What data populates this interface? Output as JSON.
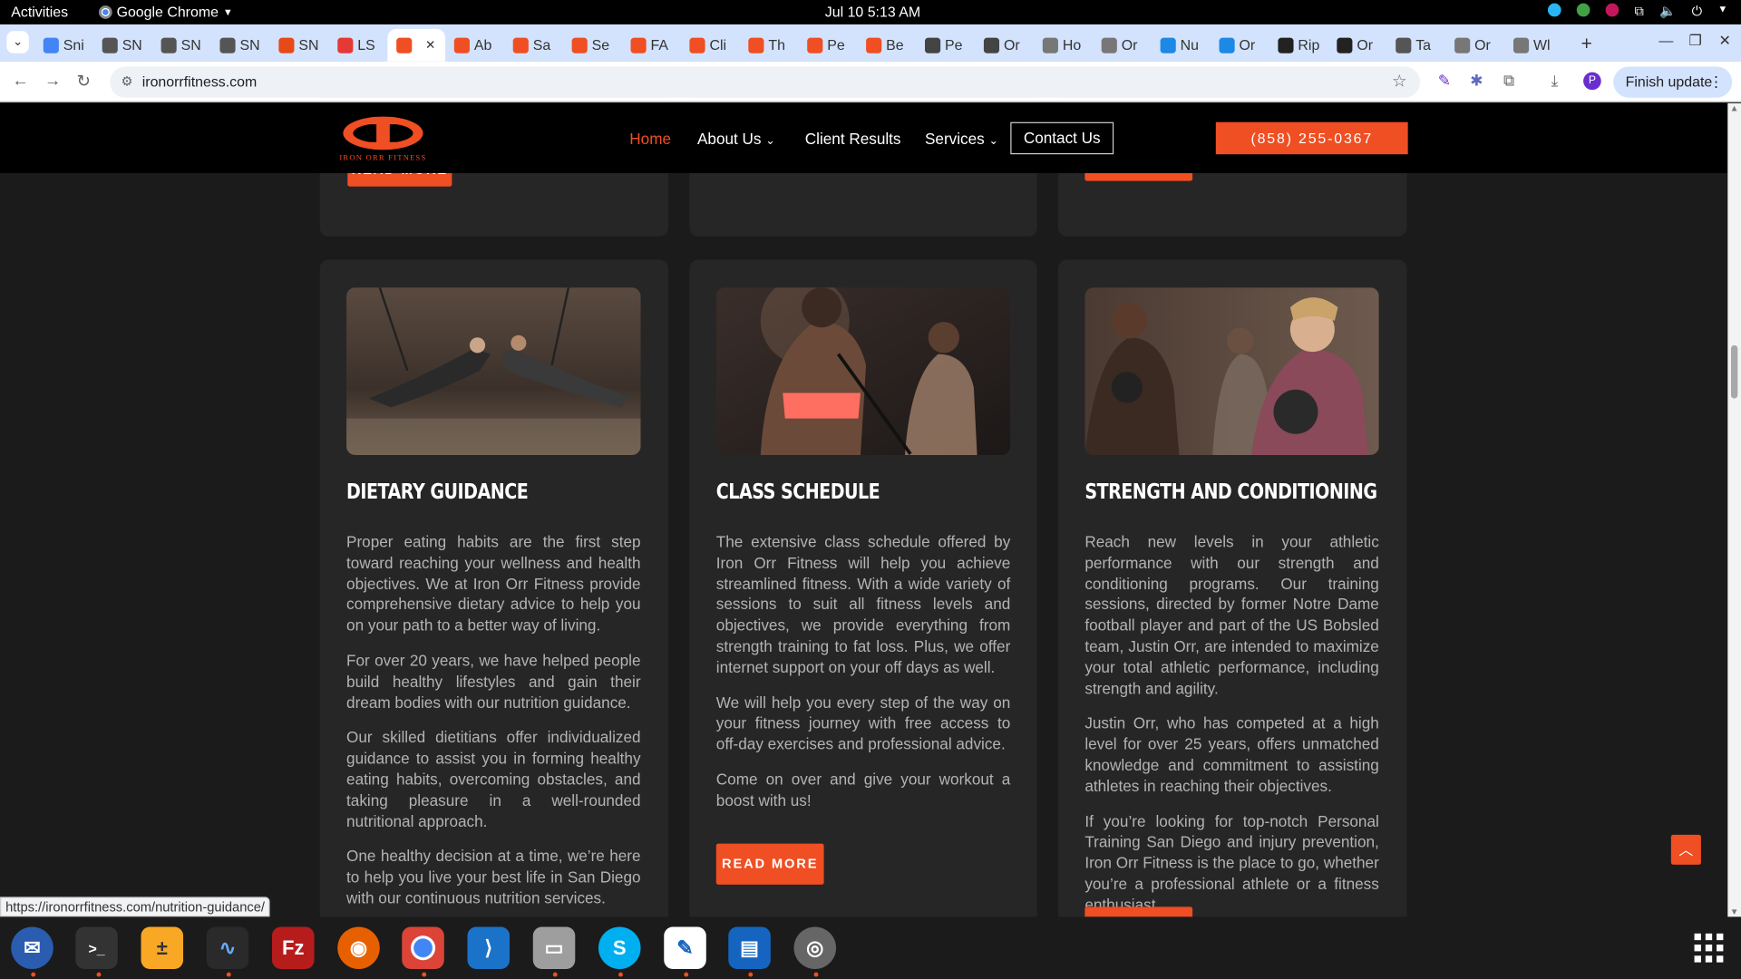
{
  "system": {
    "activities": "Activities",
    "app_name": "Google Chrome",
    "clock": "Jul 10  5:13 AM"
  },
  "tabs": [
    {
      "label": "Sni",
      "color": "#4285f4"
    },
    {
      "label": "SN",
      "color": "#555555"
    },
    {
      "label": "SN",
      "color": "#555555"
    },
    {
      "label": "SN",
      "color": "#555555"
    },
    {
      "label": "SN",
      "color": "#e64a19"
    },
    {
      "label": "LS",
      "color": "#e53935"
    },
    {
      "label": "",
      "color": "#f04e23",
      "active": true
    },
    {
      "label": "Ab",
      "color": "#f04e23"
    },
    {
      "label": "Sa",
      "color": "#f04e23"
    },
    {
      "label": "Se",
      "color": "#f04e23"
    },
    {
      "label": "FA",
      "color": "#f04e23"
    },
    {
      "label": "Cli",
      "color": "#f04e23"
    },
    {
      "label": "Th",
      "color": "#f04e23"
    },
    {
      "label": "Pe",
      "color": "#f04e23"
    },
    {
      "label": "Be",
      "color": "#f04e23"
    },
    {
      "label": "Pe",
      "color": "#444444"
    },
    {
      "label": "Or",
      "color": "#444444"
    },
    {
      "label": "Ho",
      "color": "#777777"
    },
    {
      "label": "Or",
      "color": "#777777"
    },
    {
      "label": "Nu",
      "color": "#1e88e5"
    },
    {
      "label": "Or",
      "color": "#1e88e5"
    },
    {
      "label": "Rip",
      "color": "#222222"
    },
    {
      "label": "Or",
      "color": "#222222"
    },
    {
      "label": "Ta",
      "color": "#555555"
    },
    {
      "label": "Or",
      "color": "#777777"
    },
    {
      "label": "Wl",
      "color": "#777777"
    }
  ],
  "toolbar": {
    "url": "ironorrfitness.com",
    "finish_update": "Finish update",
    "avatar_letter": "P"
  },
  "site": {
    "nav": {
      "home": "Home",
      "about": "About Us",
      "results": "Client Results",
      "services": "Services",
      "contact": "Contact Us",
      "phone": "(858) 255-0367"
    },
    "logo_text": "IRON ORR FITNESS",
    "read_more": "READ MORE"
  },
  "cards": [
    {
      "title": "DIETARY GUIDANCE",
      "paragraphs": [
        "Proper eating habits are the first step toward reaching your wellness and health objectives. We at Iron Orr Fitness provide comprehensive dietary advice to help you on your path to a better way of living.",
        "For over 20 years, we have helped people build healthy lifestyles and gain their dream bodies with our nutrition guidance.",
        "Our skilled dietitians offer individualized guidance to assist you in forming healthy eating habits, overcoming obstacles, and taking pleasure in a well-rounded nutritional approach.",
        "One healthy decision at a time, we’re here to help you live your best life in San Diego with our continuous nutrition services."
      ]
    },
    {
      "title": "CLASS SCHEDULE",
      "paragraphs": [
        "The extensive class schedule offered by Iron Orr Fitness will help you achieve streamlined fitness. With a wide variety of sessions to suit all fitness levels and objectives, we provide everything from strength training to fat loss. Plus, we offer internet support on your off days as well.",
        "We will help you every step of the way on your fitness journey with free access to off-day exercises and professional advice.",
        "Come on over and give your workout a boost with us!"
      ]
    },
    {
      "title": "STRENGTH AND CONDITIONING",
      "paragraphs": [
        "Reach new levels in your athletic performance with our strength and conditioning programs. Our training sessions, directed by former Notre Dame football player and part of the US Bobsled team, Justin Orr, are intended to maximize your total athletic performance, including strength and agility.",
        "Justin Orr, who has competed at a high level for over 25 years, offers unmatched knowledge and commitment to assisting athletes in reaching their objectives.",
        "If you’re looking for top-notch Personal Training San Diego and injury prevention, Iron Orr Fitness is the place to go, whether you’re a professional athlete or a fitness enthusiast."
      ]
    }
  ],
  "status_url": "https://ironorrfitness.com/nutrition-guidance/",
  "colors": {
    "accent": "#f04e23",
    "page_bg": "#1b1b1b",
    "card_bg": "#262626"
  }
}
